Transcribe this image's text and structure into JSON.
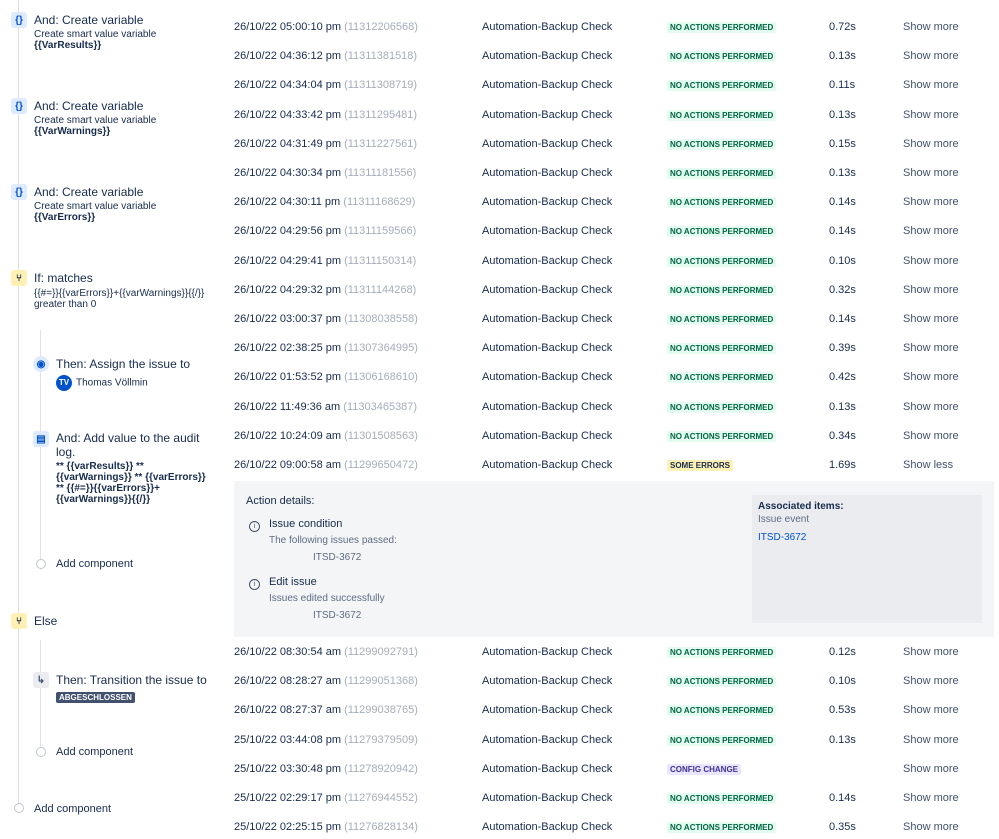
{
  "components": {
    "var_results": {
      "title": "And: Create variable",
      "sub": "Create smart value variable",
      "val": "{{VarResults}}"
    },
    "var_warnings": {
      "title": "And: Create variable",
      "sub": "Create smart value variable",
      "val": "{{VarWarnings}}"
    },
    "var_errors": {
      "title": "And: Create variable",
      "sub": "Create smart value variable",
      "val": "{{VarErrors}}"
    },
    "if_matches": {
      "title": "If: matches",
      "line1": "{{#=}}{{varErrors}}+{{varWarnings}}{{/}}",
      "line2": "greater than 0"
    },
    "assign": {
      "title": "Then: Assign the issue to",
      "avatar": "TV",
      "user": "Thomas Völlmin"
    },
    "audit": {
      "title1": "And: Add value to the audit",
      "title2": "log.",
      "l1": "** {{varResults}} **",
      "l2": "{{varWarnings}} ** {{varErrors}}",
      "l3": "** {{#=}}{{varErrors}}+",
      "l4": "{{varWarnings}}{{/}}"
    },
    "add_component_1": "Add component",
    "else_label": "Else",
    "transition": {
      "title": "Then: Transition the issue to",
      "status": "ABGESCHLOSSEN"
    },
    "add_component_2": "Add component",
    "add_component_3": "Add component"
  },
  "rows_top": [
    {
      "date": "26/10/22 05:00:10 pm",
      "id": "(11312206568)",
      "rule": "Automation-Backup Check",
      "status": "NO ACTIONS PERFORMED",
      "kind": "green",
      "time": "0.72s",
      "action": "Show more"
    },
    {
      "date": "26/10/22 04:36:12 pm",
      "id": "(11311381518)",
      "rule": "Automation-Backup Check",
      "status": "NO ACTIONS PERFORMED",
      "kind": "green",
      "time": "0.13s",
      "action": "Show more"
    },
    {
      "date": "26/10/22 04:34:04 pm",
      "id": "(11311308719)",
      "rule": "Automation-Backup Check",
      "status": "NO ACTIONS PERFORMED",
      "kind": "green",
      "time": "0.11s",
      "action": "Show more"
    },
    {
      "date": "26/10/22 04:33:42 pm",
      "id": "(11311295481)",
      "rule": "Automation-Backup Check",
      "status": "NO ACTIONS PERFORMED",
      "kind": "green",
      "time": "0.13s",
      "action": "Show more"
    },
    {
      "date": "26/10/22 04:31:49 pm",
      "id": "(11311227561)",
      "rule": "Automation-Backup Check",
      "status": "NO ACTIONS PERFORMED",
      "kind": "green",
      "time": "0.15s",
      "action": "Show more"
    },
    {
      "date": "26/10/22 04:30:34 pm",
      "id": "(11311181556)",
      "rule": "Automation-Backup Check",
      "status": "NO ACTIONS PERFORMED",
      "kind": "green",
      "time": "0.13s",
      "action": "Show more"
    },
    {
      "date": "26/10/22 04:30:11 pm",
      "id": "(11311168629)",
      "rule": "Automation-Backup Check",
      "status": "NO ACTIONS PERFORMED",
      "kind": "green",
      "time": "0.14s",
      "action": "Show more"
    },
    {
      "date": "26/10/22 04:29:56 pm",
      "id": "(11311159566)",
      "rule": "Automation-Backup Check",
      "status": "NO ACTIONS PERFORMED",
      "kind": "green",
      "time": "0.14s",
      "action": "Show more"
    },
    {
      "date": "26/10/22 04:29:41 pm",
      "id": "(11311150314)",
      "rule": "Automation-Backup Check",
      "status": "NO ACTIONS PERFORMED",
      "kind": "green",
      "time": "0.10s",
      "action": "Show more"
    },
    {
      "date": "26/10/22 04:29:32 pm",
      "id": "(11311144268)",
      "rule": "Automation-Backup Check",
      "status": "NO ACTIONS PERFORMED",
      "kind": "green",
      "time": "0.32s",
      "action": "Show more"
    },
    {
      "date": "26/10/22 03:00:37 pm",
      "id": "(11308038558)",
      "rule": "Automation-Backup Check",
      "status": "NO ACTIONS PERFORMED",
      "kind": "green",
      "time": "0.14s",
      "action": "Show more"
    },
    {
      "date": "26/10/22 02:38:25 pm",
      "id": "(11307364995)",
      "rule": "Automation-Backup Check",
      "status": "NO ACTIONS PERFORMED",
      "kind": "green",
      "time": "0.39s",
      "action": "Show more"
    },
    {
      "date": "26/10/22 01:53:52 pm",
      "id": "(11306168610)",
      "rule": "Automation-Backup Check",
      "status": "NO ACTIONS PERFORMED",
      "kind": "green",
      "time": "0.42s",
      "action": "Show more"
    },
    {
      "date": "26/10/22 11:49:36 am",
      "id": "(11303465387)",
      "rule": "Automation-Backup Check",
      "status": "NO ACTIONS PERFORMED",
      "kind": "green",
      "time": "0.13s",
      "action": "Show more"
    },
    {
      "date": "26/10/22 10:24:09 am",
      "id": "(11301508563)",
      "rule": "Automation-Backup Check",
      "status": "NO ACTIONS PERFORMED",
      "kind": "green",
      "time": "0.34s",
      "action": "Show more"
    },
    {
      "date": "26/10/22 09:00:58 am",
      "id": "(11299650472)",
      "rule": "Automation-Backup Check",
      "status": "SOME ERRORS",
      "kind": "yellow",
      "time": "1.69s",
      "action": "Show less"
    }
  ],
  "details": {
    "heading": "Action details:",
    "item1": {
      "title": "Issue condition",
      "sub": "The following issues passed:",
      "key": "ITSD-3672"
    },
    "item2": {
      "title": "Edit issue",
      "sub": "Issues edited successfully",
      "key": "ITSD-3672"
    },
    "assoc_title": "Associated items:",
    "assoc_sub": "Issue event",
    "assoc_link": "ITSD-3672"
  },
  "rows_bottom": [
    {
      "date": "26/10/22 08:30:54 am",
      "id": "(11299092791)",
      "rule": "Automation-Backup Check",
      "status": "NO ACTIONS PERFORMED",
      "kind": "green",
      "time": "0.12s",
      "action": "Show more"
    },
    {
      "date": "26/10/22 08:28:27 am",
      "id": "(11299051368)",
      "rule": "Automation-Backup Check",
      "status": "NO ACTIONS PERFORMED",
      "kind": "green",
      "time": "0.10s",
      "action": "Show more"
    },
    {
      "date": "26/10/22 08:27:37 am",
      "id": "(11299038765)",
      "rule": "Automation-Backup Check",
      "status": "NO ACTIONS PERFORMED",
      "kind": "green",
      "time": "0.53s",
      "action": "Show more"
    },
    {
      "date": "25/10/22 03:44:08 pm",
      "id": "(11279379509)",
      "rule": "Automation-Backup Check",
      "status": "NO ACTIONS PERFORMED",
      "kind": "green",
      "time": "0.13s",
      "action": "Show more"
    },
    {
      "date": "25/10/22 03:30:48 pm",
      "id": "(11278920942)",
      "rule": "Automation-Backup Check",
      "status": "CONFIG CHANGE",
      "kind": "purple",
      "time": "",
      "action": "Show more"
    },
    {
      "date": "25/10/22 02:29:17 pm",
      "id": "(11276944552)",
      "rule": "Automation-Backup Check",
      "status": "NO ACTIONS PERFORMED",
      "kind": "green",
      "time": "0.14s",
      "action": "Show more"
    },
    {
      "date": "25/10/22 02:25:15 pm",
      "id": "(11276828134)",
      "rule": "Automation-Backup Check",
      "status": "NO ACTIONS PERFORMED",
      "kind": "green",
      "time": "0.35s",
      "action": "Show more"
    }
  ]
}
